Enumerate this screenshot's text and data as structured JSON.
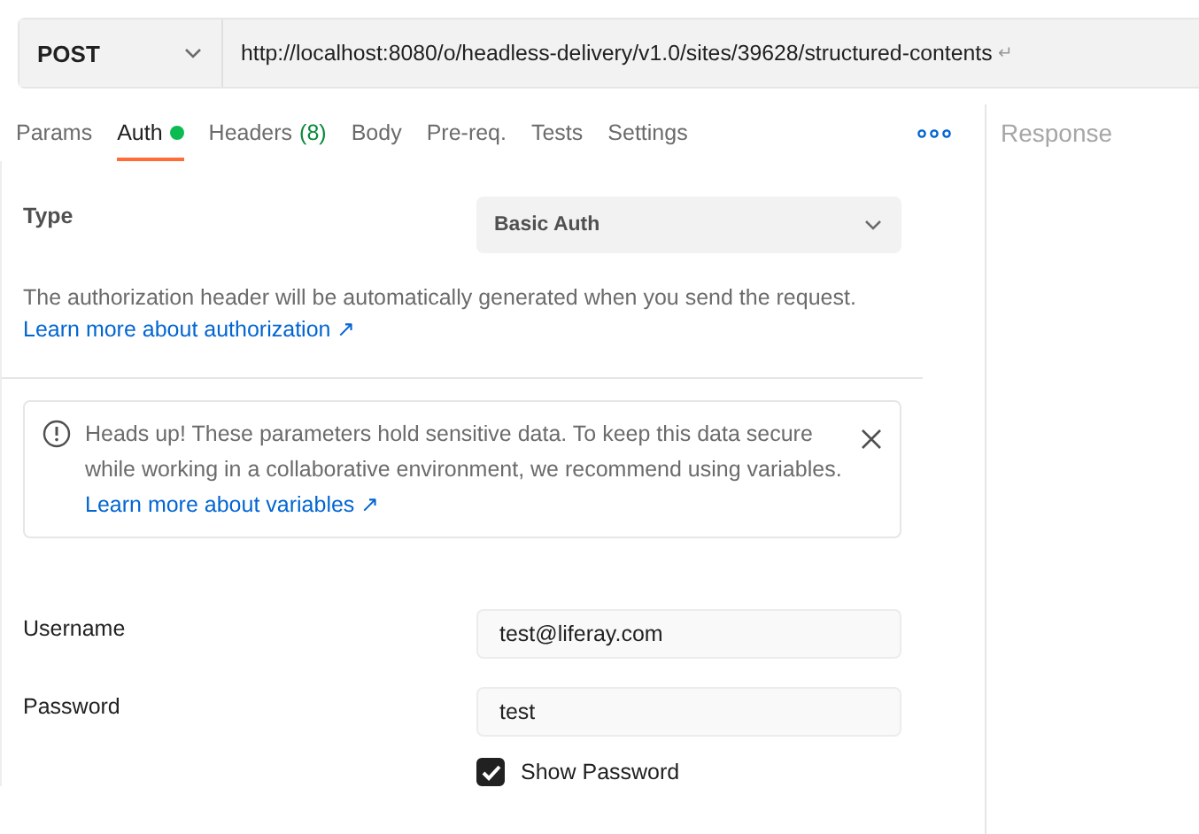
{
  "request": {
    "method": "POST",
    "url": "http://localhost:8080/o/headless-delivery/v1.0/sites/39628/structured-contents",
    "return_mark": "↵"
  },
  "tabs": [
    {
      "label": "Params",
      "selected": false,
      "dot": false
    },
    {
      "label": "Auth",
      "selected": true,
      "dot": true
    },
    {
      "label": "Headers",
      "count": "(8)",
      "selected": false,
      "dot": false
    },
    {
      "label": "Body",
      "selected": false,
      "dot": false
    },
    {
      "label": "Pre-req.",
      "selected": false,
      "dot": false
    },
    {
      "label": "Tests",
      "selected": false,
      "dot": false
    },
    {
      "label": "Settings",
      "selected": false,
      "dot": false
    }
  ],
  "response_title": "Response",
  "auth": {
    "type_label": "Type",
    "type_value": "Basic Auth",
    "description": "The authorization header will be automatically generated when you send the request.",
    "description_link": "Learn more about authorization ↗",
    "notice": {
      "text": "Heads up! These parameters hold sensitive data. To keep this data secure while working in a collaborative environment, we recommend using variables.",
      "link": "Learn more about variables ↗"
    },
    "fields": [
      {
        "label": "Username",
        "value": "test@liferay.com"
      },
      {
        "label": "Password",
        "value": "test"
      }
    ],
    "show_password": {
      "label": "Show Password",
      "checked": true
    }
  }
}
